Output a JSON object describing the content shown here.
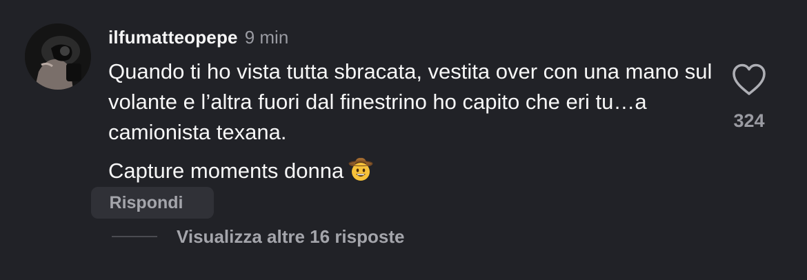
{
  "comment": {
    "username": "ilfumatteopepe",
    "time": "9 min",
    "text_paragraph_1": "Quando ti ho vista tutta sbracata, vestita over con una mano sul volante e l’altra fuori dal finestrino ho capito che eri tu…a camionista texana.",
    "text_paragraph_2": "Capture moments donna",
    "emoji": "cowboy-hat-face-emoji"
  },
  "actions": {
    "reply_label": "Rispondi",
    "view_replies_label": "Visualizza altre 16 risposte",
    "like_count": "324",
    "like_icon": "heart-outline-icon"
  },
  "colors": {
    "background": "#212227",
    "primary_text": "#f5f5f5",
    "secondary_text": "#9a9ba2",
    "reply_button_bg": "#303137"
  }
}
